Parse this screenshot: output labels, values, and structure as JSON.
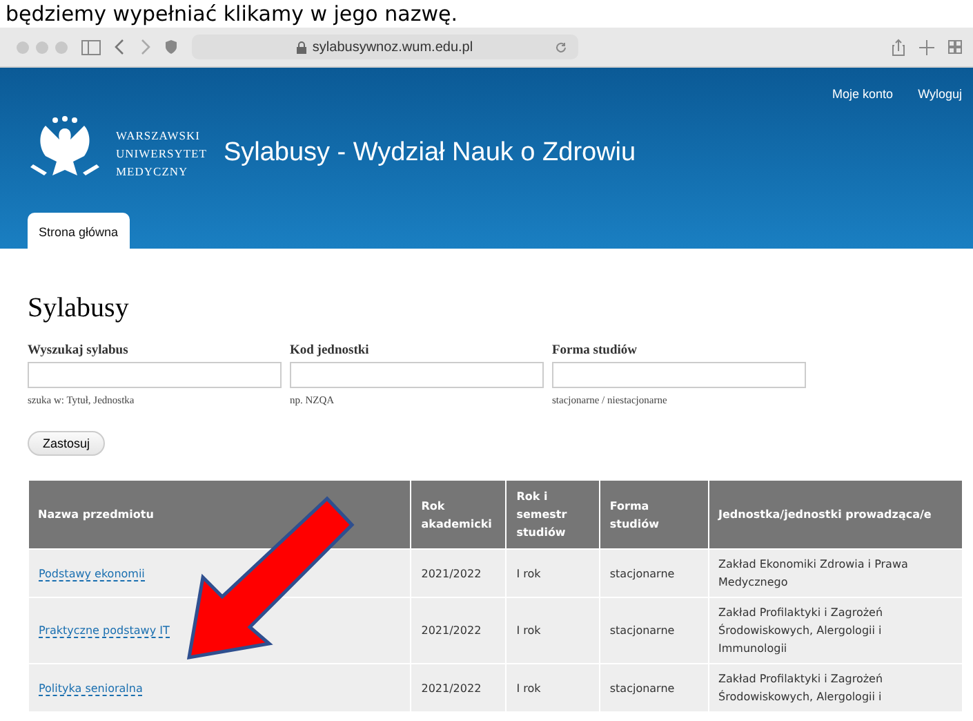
{
  "caption": "będziemy wypełniać klikamy w jego nazwę.",
  "browser": {
    "url": "sylabusywnoz.wum.edu.pl"
  },
  "header": {
    "user_links": [
      "Moje konto",
      "Wyloguj"
    ],
    "logo_lines": [
      "WARSZAWSKI",
      "UNIWERSYTET",
      "MEDYCZNY"
    ],
    "title": "Sylabusy - Wydział Nauk o Zdrowiu",
    "tabs": [
      {
        "label": "Strona główna",
        "selected": true
      }
    ]
  },
  "page_title": "Sylabusy",
  "filters": [
    {
      "label": "Wyszukaj sylabus",
      "hint": "szuka w: Tytuł, Jednostka"
    },
    {
      "label": "Kod jednostki",
      "hint": "np. NZQA"
    },
    {
      "label": "Forma studiów",
      "hint": "stacjonarne / niestacjonarne"
    }
  ],
  "apply_button": "Zastosuj",
  "table": {
    "columns": [
      "Nazwa przedmiotu",
      "Rok akademicki",
      "Rok i semestr studiów",
      "Forma studiów",
      "Jednostka/jednostki prowadząca/e"
    ],
    "rows": [
      {
        "name": "Podstawy ekonomii",
        "year": "2021/2022",
        "semester": "I rok",
        "form": "stacjonarne",
        "unit": "Zakład Ekonomiki Zdrowia i Prawa Medycznego"
      },
      {
        "name": "Praktyczne podstawy IT",
        "year": "2021/2022",
        "semester": "I rok",
        "form": "stacjonarne",
        "unit": "Zakład Profilaktyki i Zagrożeń Środowiskowych, Alergologii i Immunologii"
      },
      {
        "name": "Polityka senioralna",
        "year": "2021/2022",
        "semester": "I rok",
        "form": "stacjonarne",
        "unit": "Zakład Profilaktyki i Zagrożeń Środowiskowych, Alergologii i"
      }
    ]
  }
}
